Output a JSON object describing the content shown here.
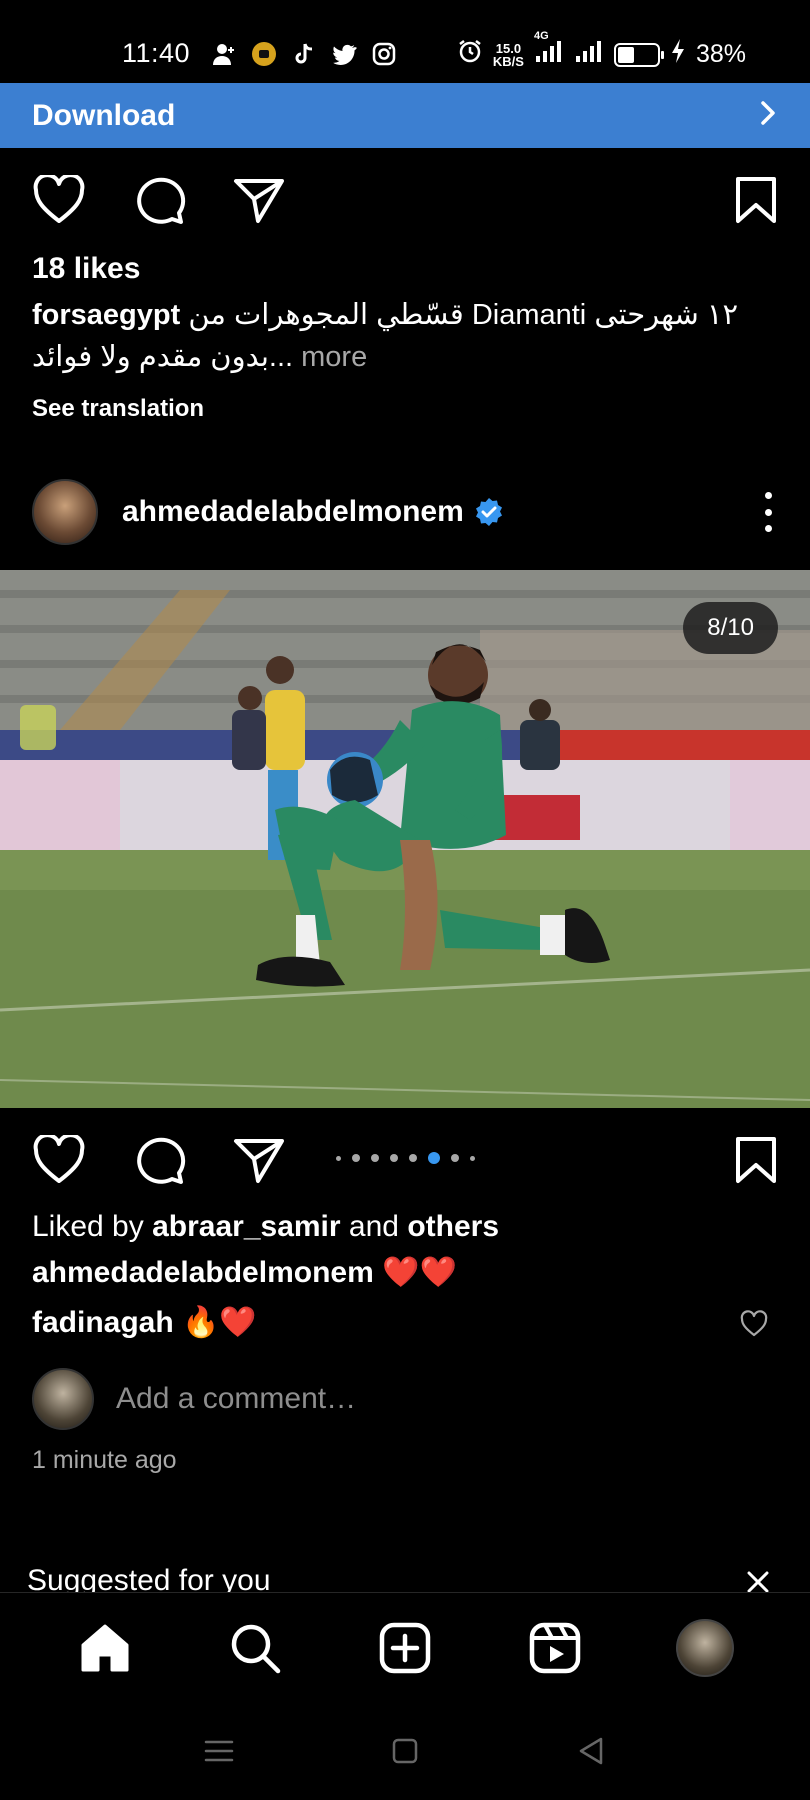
{
  "status_bar": {
    "time": "11:40",
    "speed": "15.0",
    "speed_unit": "KB/S",
    "network": "4G",
    "battery": "38%",
    "left_icons": [
      "add-contact-icon",
      "app-badge-icon",
      "tiktok-icon",
      "twitter-icon",
      "instagram-icon"
    ],
    "right_icons": [
      "alarm-icon",
      "signal-icon",
      "signal-icon",
      "battery-icon",
      "charging-icon"
    ]
  },
  "banner": {
    "label": "Download",
    "accent": "#3c7fd1"
  },
  "post_prev": {
    "likes": "18 likes",
    "caption_user": "forsaegypt",
    "caption_text": "قسّطي المجوهرات من Diamanti ١٢ شهرحتى",
    "caption_text_line2": "بدون مقدم ولا فوائد...",
    "more": "more",
    "see_translation": "See translation"
  },
  "post": {
    "username": "ahmedadelabdelmonem",
    "verified_color": "#3897f0",
    "counter": "8/10",
    "liked_by_prefix": "Liked by",
    "liked_by_user": "abraar_samir",
    "liked_by_and": "and",
    "liked_by_others": "others",
    "comments": [
      {
        "user": "ahmedadelabdelmonem",
        "text": "❤️❤️"
      },
      {
        "user": "fadinagah",
        "text": "🔥❤️"
      }
    ],
    "add_comment_placeholder": "Add a comment…",
    "timestamp": "1 minute ago",
    "carousel_dots": 8,
    "carousel_active_index": 5
  },
  "suggested": {
    "label": "Suggested for you"
  },
  "bottom_nav": [
    "home-icon",
    "search-icon",
    "create-icon",
    "reels-icon",
    "profile-avatar"
  ],
  "system_nav": [
    "menu-icon",
    "home-square-icon",
    "back-icon"
  ]
}
